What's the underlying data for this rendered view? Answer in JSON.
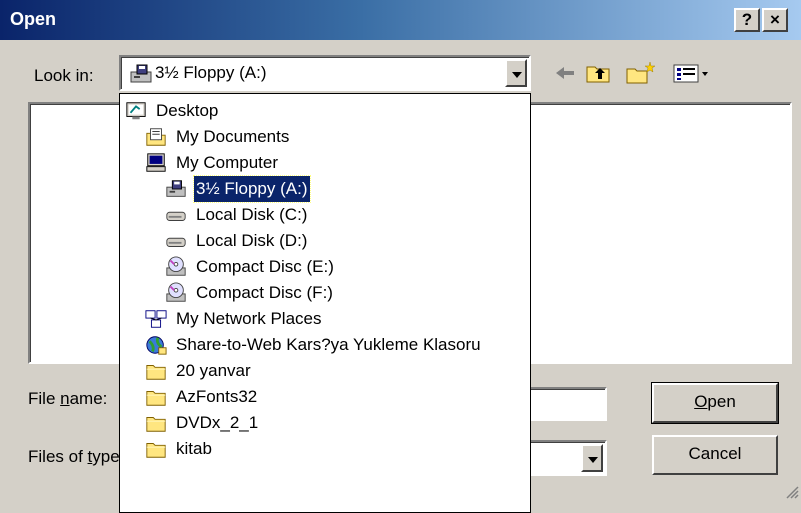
{
  "window": {
    "title": "Open",
    "help_button": "?",
    "close_button": "×"
  },
  "lookin": {
    "label": "Look in:",
    "value": "3½ Floppy (A:)",
    "icon": "floppy-drive-icon"
  },
  "toolbar": {
    "icons": [
      "back-arrow-icon",
      "up-folder-icon",
      "new-folder-icon",
      "views-menu-icon"
    ]
  },
  "dropdown": {
    "items": [
      {
        "label": "Desktop",
        "icon": "desktop-icon"
      },
      {
        "label": "My Documents",
        "icon": "my-documents-icon"
      },
      {
        "label": "My Computer",
        "icon": "my-computer-icon"
      },
      {
        "label": "3½ Floppy (A:)",
        "icon": "floppy-drive-icon",
        "selected": true
      },
      {
        "label": "Local Disk (C:)",
        "icon": "hard-disk-icon"
      },
      {
        "label": "Local Disk (D:)",
        "icon": "hard-disk-icon"
      },
      {
        "label": "Compact Disc (E:)",
        "icon": "cd-drive-icon"
      },
      {
        "label": "Compact Disc (F:)",
        "icon": "cd-drive-icon"
      },
      {
        "label": "My Network Places",
        "icon": "network-places-icon"
      },
      {
        "label": "Share-to-Web Kars?ya Yukleme Klasoru",
        "icon": "web-folder-icon"
      },
      {
        "label": "20 yanvar",
        "icon": "folder-icon"
      },
      {
        "label": "AzFonts32",
        "icon": "folder-icon"
      },
      {
        "label": "DVDx_2_1",
        "icon": "folder-icon"
      },
      {
        "label": "kitab",
        "icon": "folder-icon"
      }
    ]
  },
  "filename": {
    "label_pre": "File ",
    "label_ul": "n",
    "label_post": "ame:",
    "value": ""
  },
  "filetype": {
    "label_pre": "Files of ",
    "label_ul": "t",
    "label_post": "ype:",
    "value": ""
  },
  "buttons": {
    "open_ul": "O",
    "open_rest": "pen",
    "cancel": "Cancel"
  },
  "colors": {
    "title_start": "#0a246a",
    "title_end": "#a6caf0",
    "face": "#d4d0c8",
    "selection": "#0a246a"
  }
}
